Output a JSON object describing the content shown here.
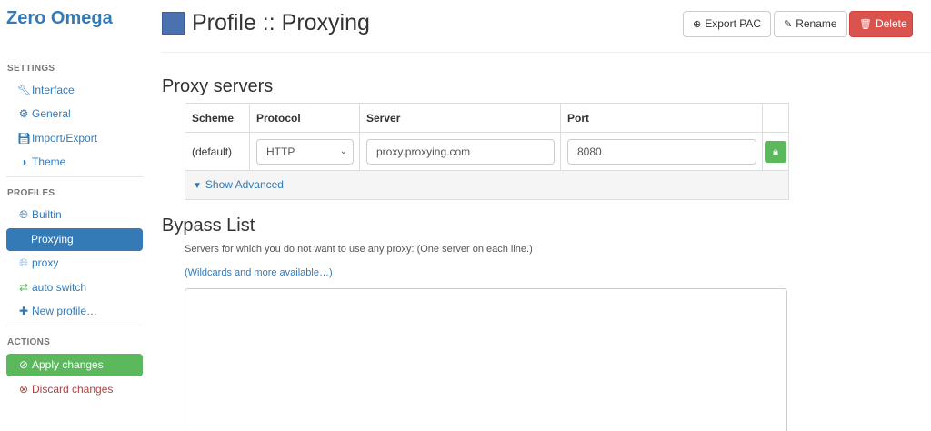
{
  "sidebar": {
    "brand": "Zero Omega",
    "settings_label": "SETTINGS",
    "settings_items": [
      {
        "label": "Interface",
        "icon": "wrench-icon"
      },
      {
        "label": "General",
        "icon": "gear-icon"
      },
      {
        "label": "Import/Export",
        "icon": "floppy-disk-icon"
      },
      {
        "label": "Theme",
        "icon": "half-circle-icon"
      }
    ],
    "profiles_label": "PROFILES",
    "profile_items": [
      {
        "label": "Builtin",
        "icon": "globe-icon"
      },
      {
        "label": "Proxying",
        "active": true
      },
      {
        "label": "proxy",
        "icon": "globe-icon"
      },
      {
        "label": "auto switch",
        "icon": "retweet-icon"
      },
      {
        "label": "New profile…",
        "icon": "plus-icon"
      }
    ],
    "actions_label": "ACTIONS",
    "apply_label": "Apply changes",
    "discard_label": "Discard changes"
  },
  "header": {
    "title": "Profile :: Proxying",
    "export_label": "Export PAC",
    "rename_label": "Rename",
    "delete_label": "Delete",
    "profile_color": "#4a72b0"
  },
  "proxy_servers": {
    "heading": "Proxy servers",
    "columns": [
      "Scheme",
      "Protocol",
      "Server",
      "Port"
    ],
    "row": {
      "scheme": "(default)",
      "protocol": "HTTP",
      "server": "proxy.proxying.com",
      "port": "8080"
    },
    "show_advanced": "Show Advanced"
  },
  "bypass": {
    "heading": "Bypass List",
    "help_text": "Servers for which you do not want to use any proxy: (One server on each line.)",
    "wildcards_link": "(Wildcards and more available…)",
    "value": ""
  },
  "colors": {
    "primary": "#337ab7",
    "success": "#5cb85c",
    "danger": "#d9534f"
  }
}
